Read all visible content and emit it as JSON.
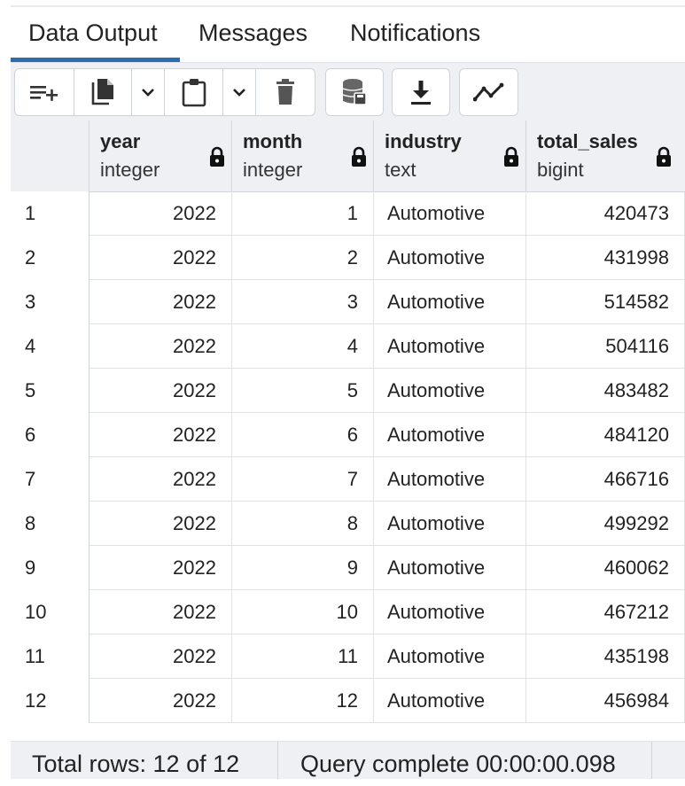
{
  "tabs": [
    {
      "label": "Data Output",
      "active": true
    },
    {
      "label": "Messages",
      "active": false
    },
    {
      "label": "Notifications",
      "active": false
    }
  ],
  "toolbar": {
    "icons": [
      "add-row-icon",
      "copy-icon",
      "chevron-down-icon",
      "paste-icon",
      "chevron-down-icon",
      "delete-icon",
      "save-data-icon",
      "download-icon",
      "graph-icon"
    ]
  },
  "columns": [
    {
      "name": "year",
      "type": "integer",
      "locked": true
    },
    {
      "name": "month",
      "type": "integer",
      "locked": true
    },
    {
      "name": "industry",
      "type": "text",
      "locked": true
    },
    {
      "name": "total_sales",
      "type": "bigint",
      "locked": true
    }
  ],
  "rows": [
    {
      "n": "1",
      "year": "2022",
      "month": "1",
      "industry": "Automotive",
      "total_sales": "420473"
    },
    {
      "n": "2",
      "year": "2022",
      "month": "2",
      "industry": "Automotive",
      "total_sales": "431998"
    },
    {
      "n": "3",
      "year": "2022",
      "month": "3",
      "industry": "Automotive",
      "total_sales": "514582"
    },
    {
      "n": "4",
      "year": "2022",
      "month": "4",
      "industry": "Automotive",
      "total_sales": "504116"
    },
    {
      "n": "5",
      "year": "2022",
      "month": "5",
      "industry": "Automotive",
      "total_sales": "483482"
    },
    {
      "n": "6",
      "year": "2022",
      "month": "6",
      "industry": "Automotive",
      "total_sales": "484120"
    },
    {
      "n": "7",
      "year": "2022",
      "month": "7",
      "industry": "Automotive",
      "total_sales": "466716"
    },
    {
      "n": "8",
      "year": "2022",
      "month": "8",
      "industry": "Automotive",
      "total_sales": "499292"
    },
    {
      "n": "9",
      "year": "2022",
      "month": "9",
      "industry": "Automotive",
      "total_sales": "460062"
    },
    {
      "n": "10",
      "year": "2022",
      "month": "10",
      "industry": "Automotive",
      "total_sales": "467212"
    },
    {
      "n": "11",
      "year": "2022",
      "month": "11",
      "industry": "Automotive",
      "total_sales": "435198"
    },
    {
      "n": "12",
      "year": "2022",
      "month": "12",
      "industry": "Automotive",
      "total_sales": "456984"
    }
  ],
  "status": {
    "total_rows": "Total rows: 12 of 12",
    "query": "Query complete 00:00:00.098"
  },
  "colors": {
    "accent": "#2c6cae",
    "toolbar_bg": "#eef0f3",
    "border": "#cfd4da"
  }
}
